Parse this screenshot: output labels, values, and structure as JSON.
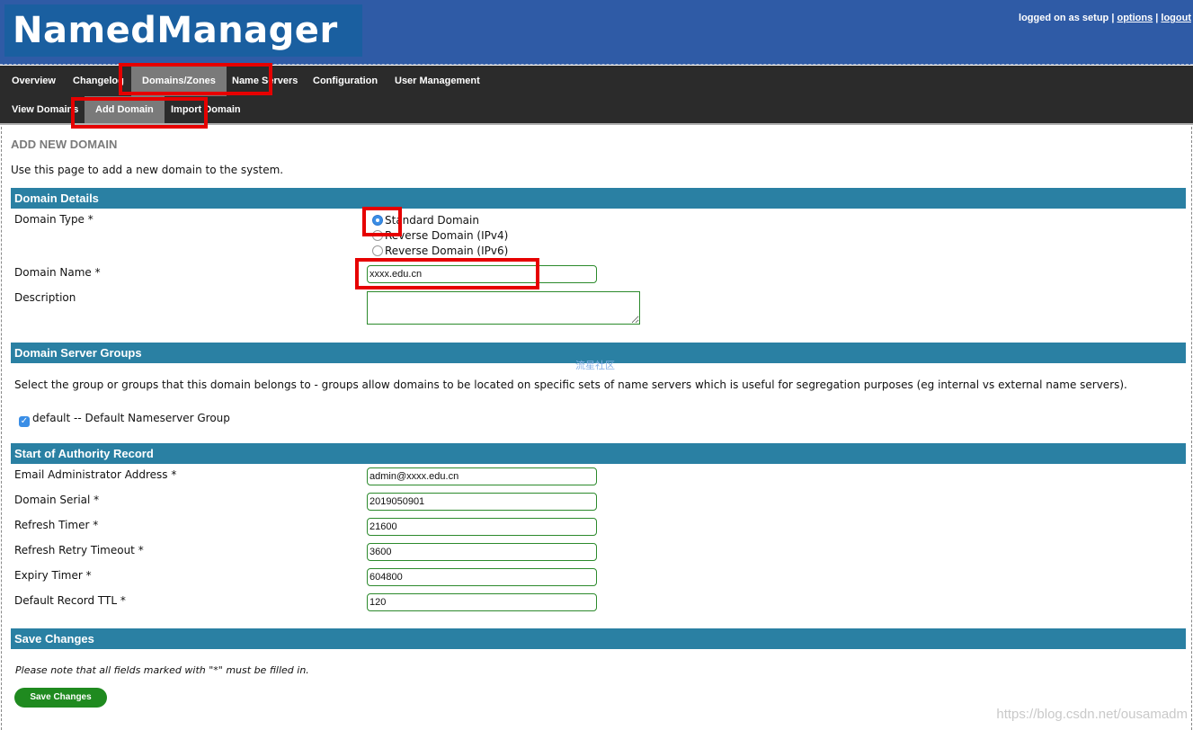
{
  "app": {
    "logo": "NamedManager",
    "user_text": "logged on as setup",
    "options_link": "options",
    "logout_link": "logout",
    "separator": "|"
  },
  "menu": {
    "primary": [
      {
        "label": "Overview"
      },
      {
        "label": "Changelog"
      },
      {
        "label": "Domains/Zones",
        "selected": true
      },
      {
        "label": "Name Servers"
      },
      {
        "label": "Configuration"
      },
      {
        "label": "User Management"
      }
    ],
    "secondary": [
      {
        "label": "View Domains"
      },
      {
        "label": "Add Domain",
        "selected": true
      },
      {
        "label": "Import Domain"
      }
    ]
  },
  "page": {
    "title": "ADD NEW DOMAIN",
    "description": "Use this page to add a new domain to the system."
  },
  "domain_details": {
    "header": "Domain Details",
    "type_label": "Domain Type *",
    "type_options": [
      {
        "label": "Standard Domain",
        "checked": true
      },
      {
        "label": "Reverse Domain (IPv4)",
        "checked": false
      },
      {
        "label": "Reverse Domain (IPv6)",
        "checked": false
      }
    ],
    "name_label": "Domain Name *",
    "name_value": "xxxx.edu.cn",
    "description_label": "Description",
    "description_value": ""
  },
  "server_groups": {
    "header": "Domain Server Groups",
    "help": "Select the group or groups that this domain belongs to - groups allow domains to be located on specific sets of name servers which is useful for segregation purposes (eg internal vs external name servers).",
    "group_label": "default -- Default Nameserver Group",
    "group_checked": true,
    "overlay_text": "流星社区"
  },
  "soa": {
    "header": "Start of Authority Record",
    "fields": [
      {
        "label": "Email Administrator Address *",
        "value": "admin@xxxx.edu.cn"
      },
      {
        "label": "Domain Serial *",
        "value": "2019050901"
      },
      {
        "label": "Refresh Timer *",
        "value": "21600"
      },
      {
        "label": "Refresh Retry Timeout *",
        "value": "3600"
      },
      {
        "label": "Expiry Timer *",
        "value": "604800"
      },
      {
        "label": "Default Record TTL *",
        "value": "120"
      }
    ]
  },
  "save": {
    "header": "Save Changes",
    "note": "Please note that all fields marked with \"*\" must be filled in.",
    "button": "Save Changes"
  },
  "watermark": "https://blog.csdn.net/ousamadm",
  "colors": {
    "header_bg": "#2f5ba6",
    "logo_bg": "#1a5fa0",
    "menu_bg": "#2b2b2b",
    "menu_selected": "#7a7a7a",
    "section_bg": "#2a80a3",
    "input_border": "#2c8a2c",
    "button_bg": "#1f8a1f",
    "highlight": "#e60000"
  }
}
